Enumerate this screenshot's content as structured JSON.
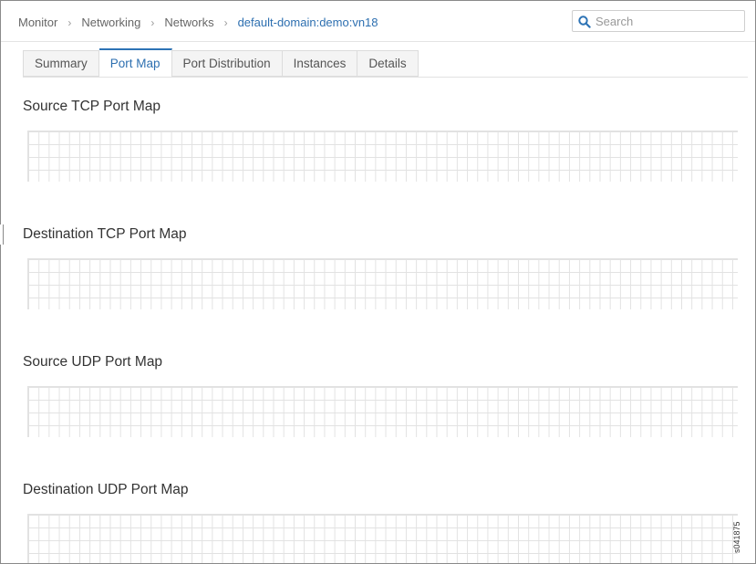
{
  "breadcrumb": {
    "items": [
      "Monitor",
      "Networking",
      "Networks",
      "default-domain:demo:vn18"
    ]
  },
  "search": {
    "placeholder": "Search",
    "value": ""
  },
  "tabs": [
    {
      "label": "Summary",
      "active": false
    },
    {
      "label": "Port Map",
      "active": true
    },
    {
      "label": "Port Distribution",
      "active": false
    },
    {
      "label": "Instances",
      "active": false
    },
    {
      "label": "Details",
      "active": false
    }
  ],
  "sections": [
    {
      "title": "Source TCP Port Map"
    },
    {
      "title": "Destination TCP Port Map"
    },
    {
      "title": "Source UDP Port Map"
    },
    {
      "title": "Destination UDP Port Map"
    }
  ],
  "figure_id": "s041875",
  "colors": {
    "accent": "#2d73b5",
    "link": "#2d6fb0",
    "grid": "#e2e2e2"
  },
  "icons": {
    "search": "search-icon",
    "separator": "chevron-right-icon"
  }
}
